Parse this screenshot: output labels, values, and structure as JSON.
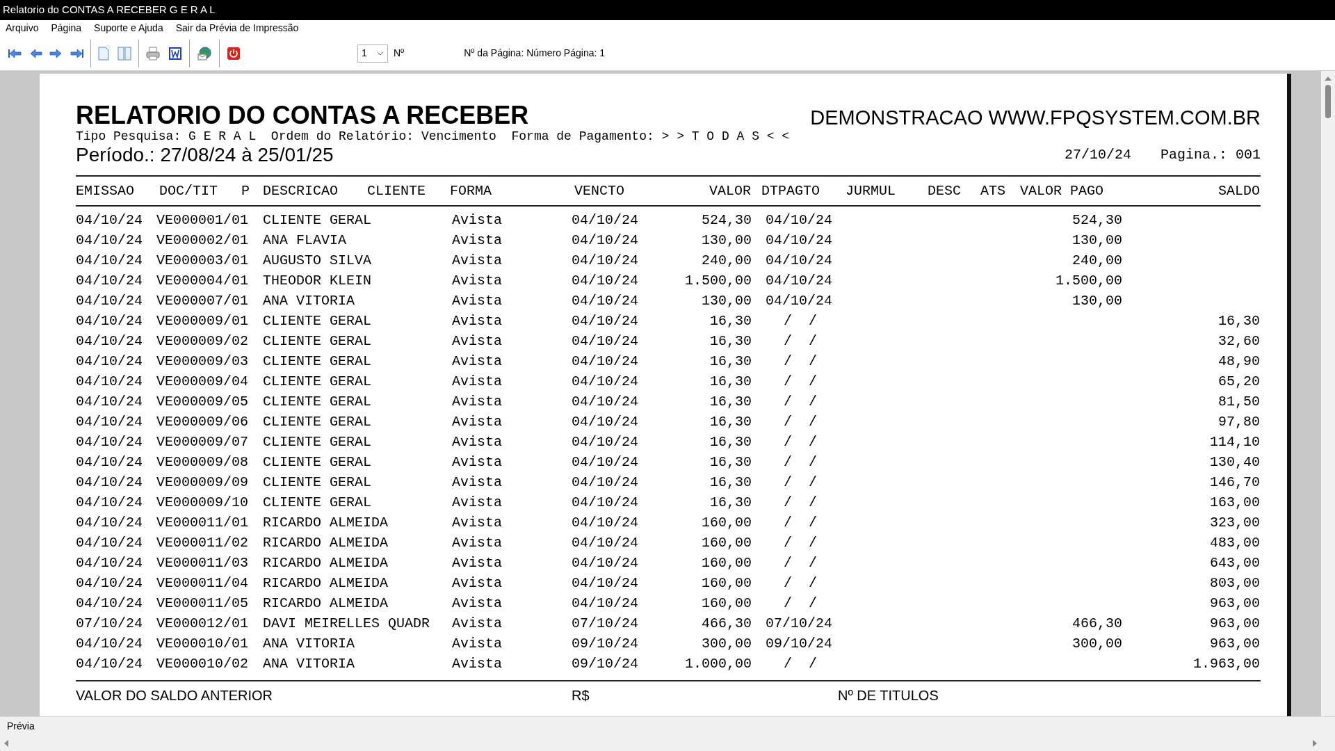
{
  "window": {
    "title": "Relatorio do CONTAS A RECEBER G E R A L"
  },
  "menu": [
    "Arquivo",
    "Página",
    "Suporte e Ajuda",
    "Sair da Prévia de Impressão"
  ],
  "toolbar": {
    "page_select": "1",
    "page_label": "Nº",
    "page_info": "Nº da Página: Número Página: 1"
  },
  "report": {
    "title": "RELATORIO DO CONTAS A RECEBER",
    "company": "DEMONSTRACAO WWW.FPQSYSTEM.COM.BR",
    "filters": "Tipo Pesquisa: G E R A L  Ordem do Relatório: Vencimento  Forma de Pagamento: > > T O D A S < <",
    "period": "Período.: 27/08/24 à 25/01/25",
    "date": "27/10/24",
    "page": "Pagina.: 001",
    "columns": [
      "EMISSAO",
      "DOC/TIT",
      "P",
      "DESCRICAO",
      "CLIENTE",
      "FORMA",
      "VENCTO",
      "VALOR",
      "DTPAGTO",
      "JURMUL",
      "DESC",
      "ATS",
      "VALOR PAGO",
      "SALDO"
    ],
    "rows": [
      {
        "emissao": "04/10/24",
        "doc": "VE000001/01",
        "descricao": "CLIENTE GERAL",
        "forma": "Avista",
        "vencto": "04/10/24",
        "valor": "524,30",
        "dtpagto": "04/10/24",
        "valor_pago": "524,30"
      },
      {
        "emissao": "04/10/24",
        "doc": "VE000002/01",
        "descricao": "ANA FLAVIA",
        "forma": "Avista",
        "vencto": "04/10/24",
        "valor": "130,00",
        "dtpagto": "04/10/24",
        "valor_pago": "130,00"
      },
      {
        "emissao": "04/10/24",
        "doc": "VE000003/01",
        "descricao": "AUGUSTO SILVA",
        "forma": "Avista",
        "vencto": "04/10/24",
        "valor": "240,00",
        "dtpagto": "04/10/24",
        "valor_pago": "240,00"
      },
      {
        "emissao": "04/10/24",
        "doc": "VE000004/01",
        "descricao": "THEODOR KLEIN",
        "forma": "Avista",
        "vencto": "04/10/24",
        "valor": "1.500,00",
        "dtpagto": "04/10/24",
        "valor_pago": "1.500,00"
      },
      {
        "emissao": "04/10/24",
        "doc": "VE000007/01",
        "descricao": "ANA VITORIA",
        "forma": "Avista",
        "vencto": "04/10/24",
        "valor": "130,00",
        "dtpagto": "04/10/24",
        "valor_pago": "130,00"
      },
      {
        "emissao": "04/10/24",
        "doc": "VE000009/01",
        "descricao": "CLIENTE GERAL",
        "forma": "Avista",
        "vencto": "04/10/24",
        "valor": "16,30",
        "dtpagto": "/  /",
        "saldo": "16,30"
      },
      {
        "emissao": "04/10/24",
        "doc": "VE000009/02",
        "descricao": "CLIENTE GERAL",
        "forma": "Avista",
        "vencto": "04/10/24",
        "valor": "16,30",
        "dtpagto": "/  /",
        "saldo": "32,60"
      },
      {
        "emissao": "04/10/24",
        "doc": "VE000009/03",
        "descricao": "CLIENTE GERAL",
        "forma": "Avista",
        "vencto": "04/10/24",
        "valor": "16,30",
        "dtpagto": "/  /",
        "saldo": "48,90"
      },
      {
        "emissao": "04/10/24",
        "doc": "VE000009/04",
        "descricao": "CLIENTE GERAL",
        "forma": "Avista",
        "vencto": "04/10/24",
        "valor": "16,30",
        "dtpagto": "/  /",
        "saldo": "65,20"
      },
      {
        "emissao": "04/10/24",
        "doc": "VE000009/05",
        "descricao": "CLIENTE GERAL",
        "forma": "Avista",
        "vencto": "04/10/24",
        "valor": "16,30",
        "dtpagto": "/  /",
        "saldo": "81,50"
      },
      {
        "emissao": "04/10/24",
        "doc": "VE000009/06",
        "descricao": "CLIENTE GERAL",
        "forma": "Avista",
        "vencto": "04/10/24",
        "valor": "16,30",
        "dtpagto": "/  /",
        "saldo": "97,80"
      },
      {
        "emissao": "04/10/24",
        "doc": "VE000009/07",
        "descricao": "CLIENTE GERAL",
        "forma": "Avista",
        "vencto": "04/10/24",
        "valor": "16,30",
        "dtpagto": "/  /",
        "saldo": "114,10"
      },
      {
        "emissao": "04/10/24",
        "doc": "VE000009/08",
        "descricao": "CLIENTE GERAL",
        "forma": "Avista",
        "vencto": "04/10/24",
        "valor": "16,30",
        "dtpagto": "/  /",
        "saldo": "130,40"
      },
      {
        "emissao": "04/10/24",
        "doc": "VE000009/09",
        "descricao": "CLIENTE GERAL",
        "forma": "Avista",
        "vencto": "04/10/24",
        "valor": "16,30",
        "dtpagto": "/  /",
        "saldo": "146,70"
      },
      {
        "emissao": "04/10/24",
        "doc": "VE000009/10",
        "descricao": "CLIENTE GERAL",
        "forma": "Avista",
        "vencto": "04/10/24",
        "valor": "16,30",
        "dtpagto": "/  /",
        "saldo": "163,00"
      },
      {
        "emissao": "04/10/24",
        "doc": "VE000011/01",
        "descricao": "RICARDO ALMEIDA",
        "forma": "Avista",
        "vencto": "04/10/24",
        "valor": "160,00",
        "dtpagto": "/  /",
        "saldo": "323,00"
      },
      {
        "emissao": "04/10/24",
        "doc": "VE000011/02",
        "descricao": "RICARDO ALMEIDA",
        "forma": "Avista",
        "vencto": "04/10/24",
        "valor": "160,00",
        "dtpagto": "/  /",
        "saldo": "483,00"
      },
      {
        "emissao": "04/10/24",
        "doc": "VE000011/03",
        "descricao": "RICARDO ALMEIDA",
        "forma": "Avista",
        "vencto": "04/10/24",
        "valor": "160,00",
        "dtpagto": "/  /",
        "saldo": "643,00"
      },
      {
        "emissao": "04/10/24",
        "doc": "VE000011/04",
        "descricao": "RICARDO ALMEIDA",
        "forma": "Avista",
        "vencto": "04/10/24",
        "valor": "160,00",
        "dtpagto": "/  /",
        "saldo": "803,00"
      },
      {
        "emissao": "04/10/24",
        "doc": "VE000011/05",
        "descricao": "RICARDO ALMEIDA",
        "forma": "Avista",
        "vencto": "04/10/24",
        "valor": "160,00",
        "dtpagto": "/  /",
        "saldo": "963,00"
      },
      {
        "emissao": "07/10/24",
        "doc": "VE000012/01",
        "descricao": "DAVI MEIRELLES QUADR",
        "forma": "Avista",
        "vencto": "07/10/24",
        "valor": "466,30",
        "dtpagto": "07/10/24",
        "valor_pago": "466,30",
        "saldo": "963,00"
      },
      {
        "emissao": "04/10/24",
        "doc": "VE000010/01",
        "descricao": "ANA VITORIA",
        "forma": "Avista",
        "vencto": "09/10/24",
        "valor": "300,00",
        "dtpagto": "09/10/24",
        "valor_pago": "300,00",
        "saldo": "963,00"
      },
      {
        "emissao": "04/10/24",
        "doc": "VE000010/02",
        "descricao": "ANA VITORIA",
        "forma": "Avista",
        "vencto": "09/10/24",
        "valor": "1.000,00",
        "dtpagto": "/  /",
        "saldo": "1.963,00"
      }
    ],
    "footer": [
      "VALOR DO SALDO ANTERIOR",
      "R$",
      "Nº DE TITULOS"
    ]
  },
  "status_bar": "Prévia"
}
